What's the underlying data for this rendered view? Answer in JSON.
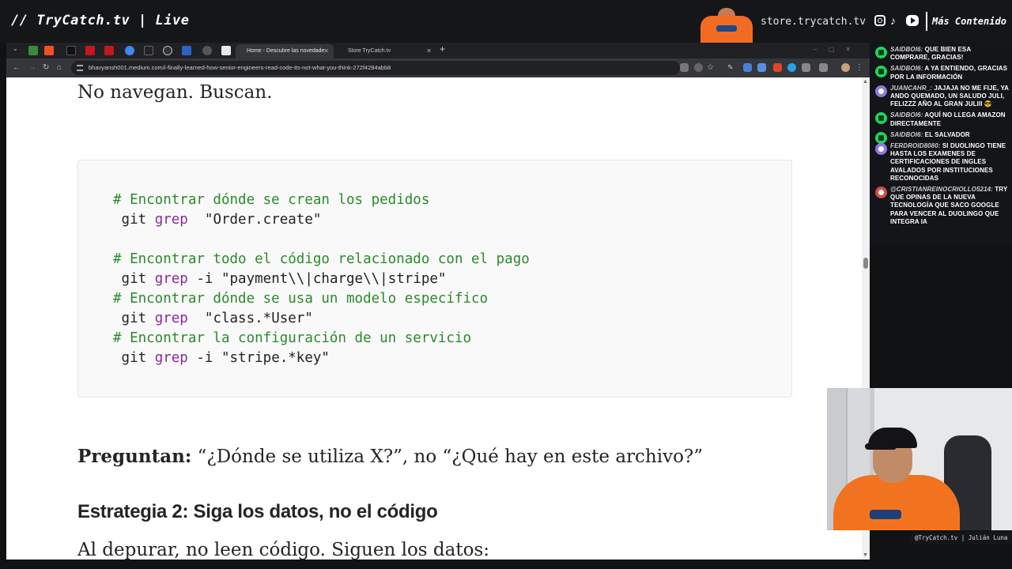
{
  "overlay": {
    "brand": "// TryCatch.tv | Live",
    "store": "store.trycatch.tv",
    "more": "Más Contenido",
    "cam_label": "@TryCatch.tv | Julián Luna"
  },
  "browser": {
    "tabs": [
      {
        "label": "Home - Descubre las novedade"
      },
      {
        "label": "Store TryCatch.tv"
      }
    ],
    "url": "bhavyansh001.medium.com/i-finally-learned-how-senior-engineers-read-code-its-not-what-you-think-272f4284abb8"
  },
  "article": {
    "para_top": "No navegan. Buscan.",
    "code": [
      {
        "type": "comment",
        "text": "# Encontrar dónde se crean los pedidos"
      },
      {
        "type": "cmd",
        "git": " git ",
        "grep": "grep",
        "rest": "  \"Order.create\""
      },
      {
        "type": "blank",
        "text": ""
      },
      {
        "type": "comment",
        "text": "# Encontrar todo el código relacionado con el pago"
      },
      {
        "type": "cmd",
        "git": " git ",
        "grep": "grep",
        "rest": " -i \"payment\\\\|charge\\\\|stripe\""
      },
      {
        "type": "comment",
        "text": "# Encontrar dónde se usa un modelo específico"
      },
      {
        "type": "cmd",
        "git": " git ",
        "grep": "grep",
        "rest": "  \"class.*User\""
      },
      {
        "type": "comment",
        "text": "# Encontrar la configuración de un servicio"
      },
      {
        "type": "cmd",
        "git": " git ",
        "grep": "grep",
        "rest": " -i \"stripe.*key\""
      }
    ],
    "question_bold": "Preguntan:",
    "question_rest": " “¿Dónde se utiliza X?”, no “¿Qué hay en este archivo?”",
    "heading": "Estrategia 2: Siga los datos, no el código",
    "para_last": "Al depurar, no leen código. Siguen los datos:"
  },
  "chat": [
    {
      "user": "saidboi6:",
      "text": "que bien esa comprare, gracias!",
      "badge": "green"
    },
    {
      "user": "saidboi6:",
      "text": "a ya entiendo, gracias por la información",
      "badge": "green"
    },
    {
      "user": "juancahr_:",
      "text": "jajaja no me fije, ya ando quemado, un saludo Juli, felizzz año al gran Juliii 😎",
      "badge": "purple"
    },
    {
      "user": "saidboi6:",
      "text": "aquí no llega amazon directamente",
      "badge": "green"
    },
    {
      "user": "saidboi6:",
      "text": "el salvador",
      "badge": "green"
    },
    {
      "user": "ferdroid8080:",
      "text": "si duolingo tiene hasta los examenes de certificaciones de ingles avalados por instituciones reconocidas",
      "badge": "purple"
    },
    {
      "user": "@cristianreinocriollo5214:",
      "text": "try que opinas de la nueva tecnología que saco google para vencer al duolingo que integra ia",
      "badge": "red"
    }
  ]
}
